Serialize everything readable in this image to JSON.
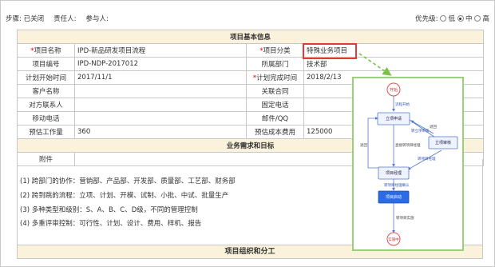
{
  "topbar": {
    "step": "步骤: 已关闭",
    "owner": "责任人:",
    "participants": "参与人:",
    "priority_label": "优先级:",
    "priority_options": [
      "低",
      "中",
      "高"
    ],
    "priority_selected": "中"
  },
  "sections": {
    "basic": "项目基本信息",
    "business": "业务需求和目标",
    "org": "项目组织和分工"
  },
  "fields": {
    "project_name_label": "项目名称",
    "project_name": "IPD-新品研发项目流程",
    "project_type_label": "项目分类",
    "project_type": "特殊业务项目",
    "project_no_label": "项目编号",
    "project_no": "IPD-NDP-2017012",
    "dept_label": "所属部门",
    "dept": "技术部",
    "plan_start_label": "计划开始时间",
    "plan_start": "2017/11/1",
    "plan_end_label": "计划完成时间",
    "plan_end": "2018/2/13",
    "customer_label": "客户名称",
    "contract_label": "关联合同",
    "contact_label": "对方联系人",
    "phone_label": "固定电话",
    "mobile_label": "移动电话",
    "email_label": "邮件/QQ",
    "workload_label": "预估工作量",
    "workload": "360",
    "cost_label": "预估成本费用",
    "cost": "125000",
    "attachment_label": "附件"
  },
  "requirements": [
    "(1) 跨部门的协作：营销部、产品部、开发部、质量部、工艺部、财务部",
    "(2) 跨到跳的流程：立项、计划、开模、试制、小批、中试、批量生产",
    "(3) 多种类型和级别：S、A、B、C、D级，不同的管理控制",
    "(4) 多重评审控制：可行性、计划、设计、费用、样机、报告"
  ],
  "flow": {
    "start": "开始",
    "process_start": "流程开始",
    "apply": "立项申请",
    "review": "立项审核",
    "submit_review": "转立项审核",
    "back1": "退回",
    "back2": "退回",
    "direct": "直接转项目经理",
    "to_pm": "转项目经理",
    "pm": "项目经理",
    "to_team": "转项目经理确认",
    "launch": "项目启动",
    "to_impl": "转项目实施",
    "end": "实施中"
  },
  "colors": {
    "section_bg": "#fbf2dc",
    "required": "#dd0000",
    "highlight": "#e53935",
    "popup_border": "#9bd07a",
    "active_node": "#2b6be4"
  }
}
